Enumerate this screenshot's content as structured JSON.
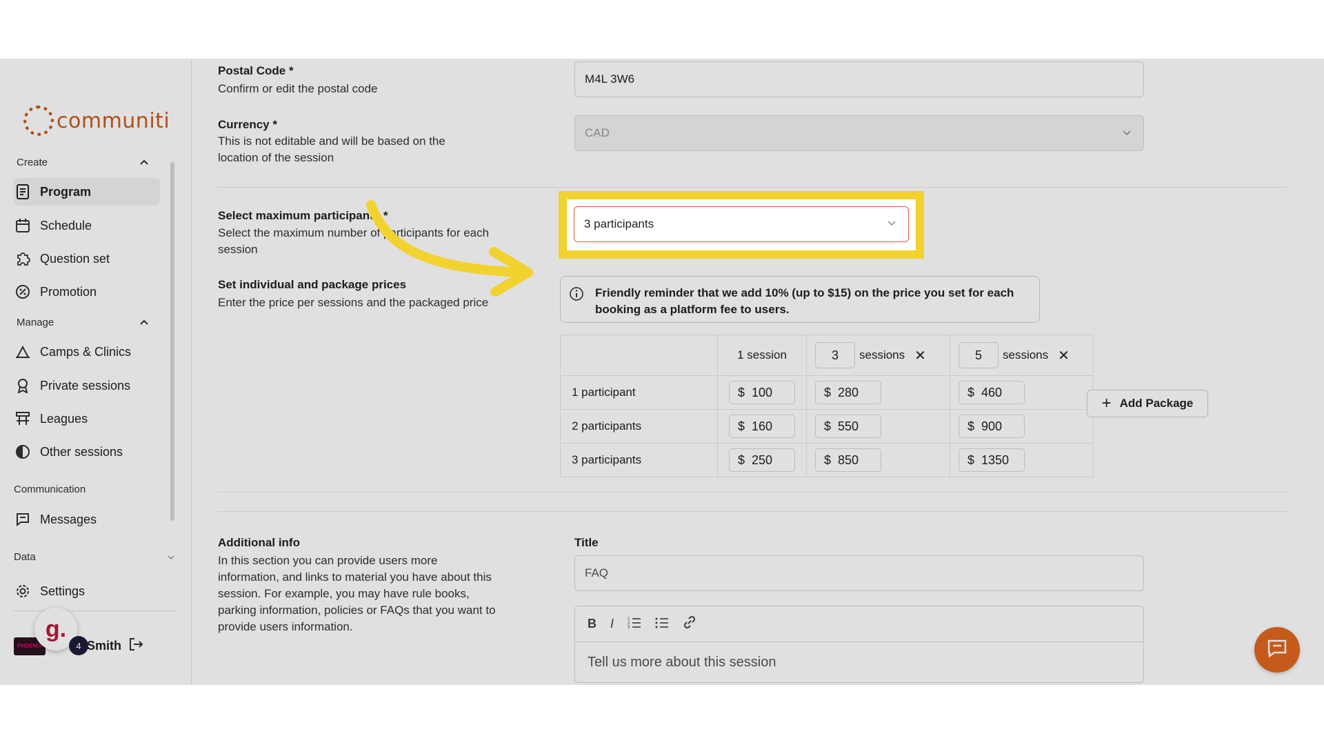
{
  "app": {
    "brand": "communiti",
    "accent": "#c85a1e"
  },
  "sidebar": {
    "create_label": "Create",
    "create_items": [
      {
        "label": "Program",
        "icon": "document-icon",
        "active": true
      },
      {
        "label": "Schedule",
        "icon": "calendar-icon"
      },
      {
        "label": "Question set",
        "icon": "puzzle-icon"
      },
      {
        "label": "Promotion",
        "icon": "percent-icon"
      }
    ],
    "manage_label": "Manage",
    "manage_items": [
      {
        "label": "Camps & Clinics",
        "icon": "camp-icon"
      },
      {
        "label": "Private sessions",
        "icon": "award-icon"
      },
      {
        "label": "Leagues",
        "icon": "bracket-icon"
      },
      {
        "label": "Other sessions",
        "icon": "half-circle-icon"
      }
    ],
    "communication_label": "Communication",
    "messages_label": "Messages",
    "data_label": "Data",
    "settings_label": "Settings",
    "user": {
      "org_logo": "PHOENIX",
      "name": "Smith",
      "notif_count": "4",
      "badge_letter": "g."
    }
  },
  "form": {
    "postal": {
      "title": "Postal Code *",
      "desc": "Confirm or edit the postal code",
      "value": "M4L 3W6"
    },
    "currency": {
      "title": "Currency *",
      "desc": "This is not editable and will be based on the location of the session",
      "value": "CAD"
    },
    "max_participants": {
      "title": "Select maximum participants *",
      "desc": "Select the maximum number of participants for each session",
      "value": "3 participants"
    },
    "prices": {
      "title": "Set individual and package prices",
      "desc": "Enter the price per sessions and the packaged price",
      "notice": "Friendly reminder that we add 10% (up to $15) on the price you set for each booking as a platform fee to users.",
      "col1": "1 session",
      "pkg1_count": "3",
      "pkg2_count": "5",
      "sessions_word": "sessions",
      "currency_symbol": "$",
      "rows": [
        {
          "label": "1 participant",
          "p1": "100",
          "p2": "280",
          "p3": "460"
        },
        {
          "label": "2 participants",
          "p1": "160",
          "p2": "550",
          "p3": "900"
        },
        {
          "label": "3 participants",
          "p1": "250",
          "p2": "850",
          "p3": "1350"
        }
      ],
      "add_package": "Add Package"
    },
    "additional": {
      "title": "Additional info",
      "desc": "In this section you can provide users more information, and links to material you have about this session. For example, you may have rule books, parking information, policies or FAQs that you want to provide users information.",
      "field_title": "Title",
      "title_value": "FAQ",
      "editor_placeholder": "Tell us more about this session",
      "toolbar": [
        "B",
        "I",
        "ordered-list",
        "bullet-list",
        "link"
      ]
    }
  }
}
